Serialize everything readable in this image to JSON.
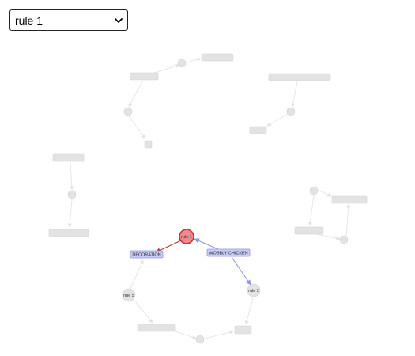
{
  "rule_select": {
    "selected": "rule 1",
    "chevron_icon": "chevron-down-icon"
  },
  "graph": {
    "active_rule": "rule 1",
    "tags": {
      "decoration": "DECORATION",
      "wobbly": "WOBBLY CHICKEN"
    },
    "rules": {
      "rule2": "rule 2",
      "rule5": "rule 5"
    },
    "colors": {
      "active": "#ef8a8a",
      "active_edge": "#c83030",
      "tag": "#c9ccf5",
      "tag_edge": "#8f95e0",
      "ghost": "#e3e3e3"
    }
  }
}
